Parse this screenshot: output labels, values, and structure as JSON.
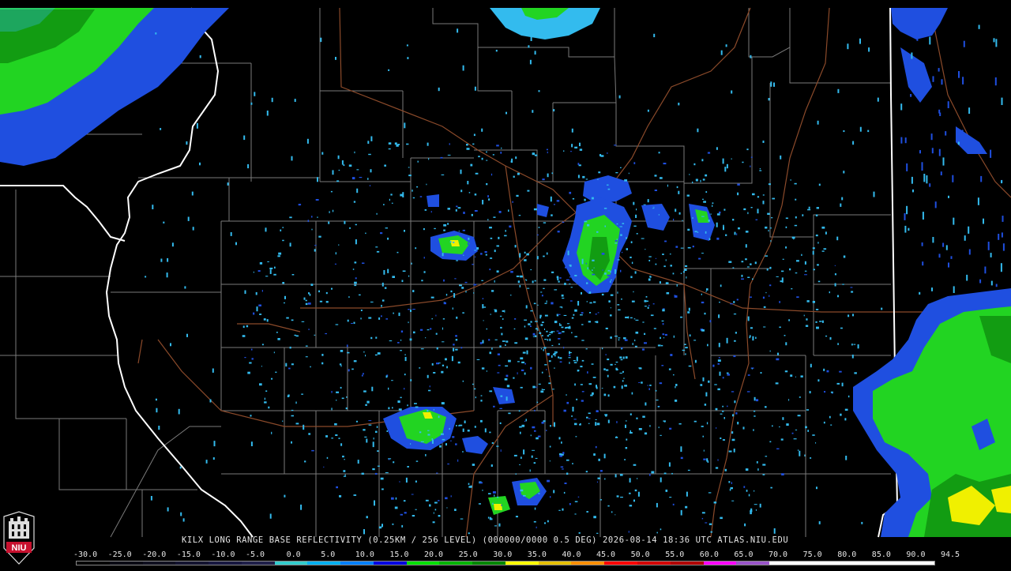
{
  "product": {
    "title": "KILX LONG RANGE BASE REFLECTIVITY (0.25KM / 256 LEVEL) (000000/0000 0.5 DEG) 2026-08-14 18:36 UTC  ATLAS.NIU.EDU"
  },
  "logo": {
    "text": "NIU",
    "icon": "niu-seal-logo-icon",
    "color": "#c8102e"
  },
  "colorbar": {
    "labels": [
      "-30.0",
      "-25.0",
      "-20.0",
      "-15.0",
      "-10.0",
      "-5.0",
      "0.0",
      "5.0",
      "10.0",
      "15.0",
      "20.0",
      "25.0",
      "30.0",
      "35.0",
      "40.0",
      "45.0",
      "50.0",
      "55.0",
      "60.0",
      "65.0",
      "70.0",
      "75.0",
      "80.0",
      "85.0",
      "90.0",
      "94.5"
    ],
    "colors": [
      "#000000",
      "#0a0a14",
      "#101020",
      "#141430",
      "#181840",
      "#20204a",
      "#33cccc",
      "#00b0f0",
      "#0080ff",
      "#0000e0",
      "#00e000",
      "#00b400",
      "#008800",
      "#ffff00",
      "#e6c000",
      "#ff9000",
      "#ff0000",
      "#d40000",
      "#b00000",
      "#ff00ff",
      "#9955c9",
      "#ffffff",
      "#ffffff",
      "#ffffff",
      "#ffffff",
      "#ffffff"
    ]
  },
  "map_colors": {
    "background": "#000000",
    "county_lines": "#7a7a7a",
    "state_lines": "#ffffff",
    "highways": "#8b4a2a",
    "dbz_light": "#33bbee",
    "dbz_blue": "#1f4fe0",
    "dbz_green": "#22d422",
    "dbz_darkgreen": "#129c12",
    "dbz_yellow": "#f0f000"
  }
}
